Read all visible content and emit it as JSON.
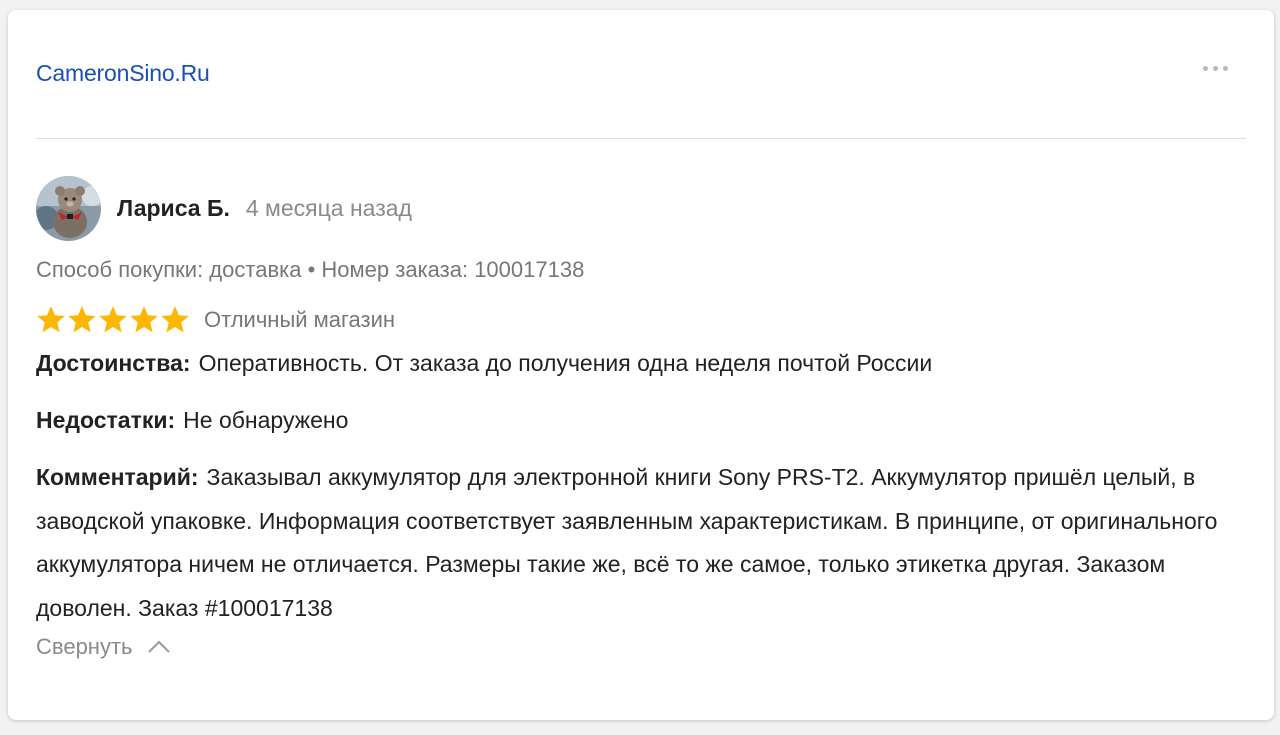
{
  "shop": {
    "name": "CameronSino.Ru"
  },
  "review": {
    "author": "Лариса Б.",
    "date": "4 месяца назад",
    "purchase_info": "Способ покупки: доставка • Номер заказа: 100017138",
    "rating": 5,
    "rating_max": 5,
    "rating_text": "Отличный магазин",
    "pros_label": "Достоинства:",
    "pros_text": "Оперативность. От заказа до получения одна неделя почтой России",
    "cons_label": "Недостатки:",
    "cons_text": "Не обнаружено",
    "comment_label": "Комментарий:",
    "comment_text": "Заказывал аккумулятор для электронной книги Sony PRS-T2. Аккумулятор пришёл целый, в заводской упаковке. Информация соответствует заявленным характеристикам. В принципе, от оригинального аккумулятора ничем не отличается. Размеры такие же, всё то же самое, только этикетка другая. Заказом доволен. Заказ #100017138",
    "collapse_label": "Свернуть"
  },
  "colors": {
    "link": "#1a4fb4",
    "star": "#fcb800",
    "muted": "#8a8a8a"
  },
  "icons": {
    "more": "more-dots-icon",
    "star": "star-icon",
    "collapse": "chevron-up-icon"
  }
}
